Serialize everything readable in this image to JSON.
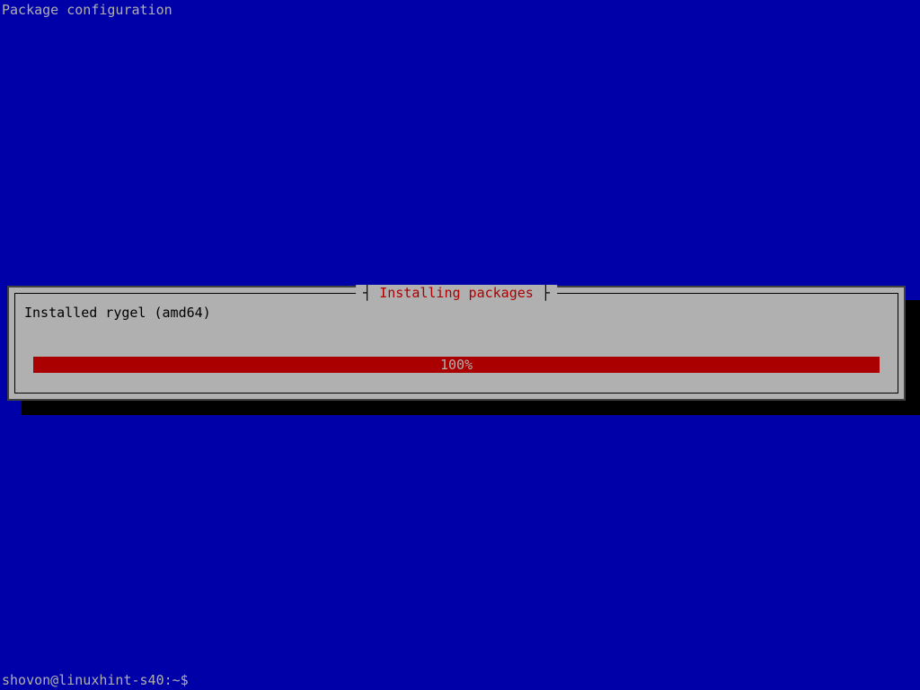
{
  "header": {
    "title": "Package configuration"
  },
  "dialog": {
    "title": "Installing packages",
    "status_text": "Installed rygel (amd64)",
    "progress_percent": "100%"
  },
  "prompt": {
    "text": "shovon@linuxhint-s40:~$"
  }
}
